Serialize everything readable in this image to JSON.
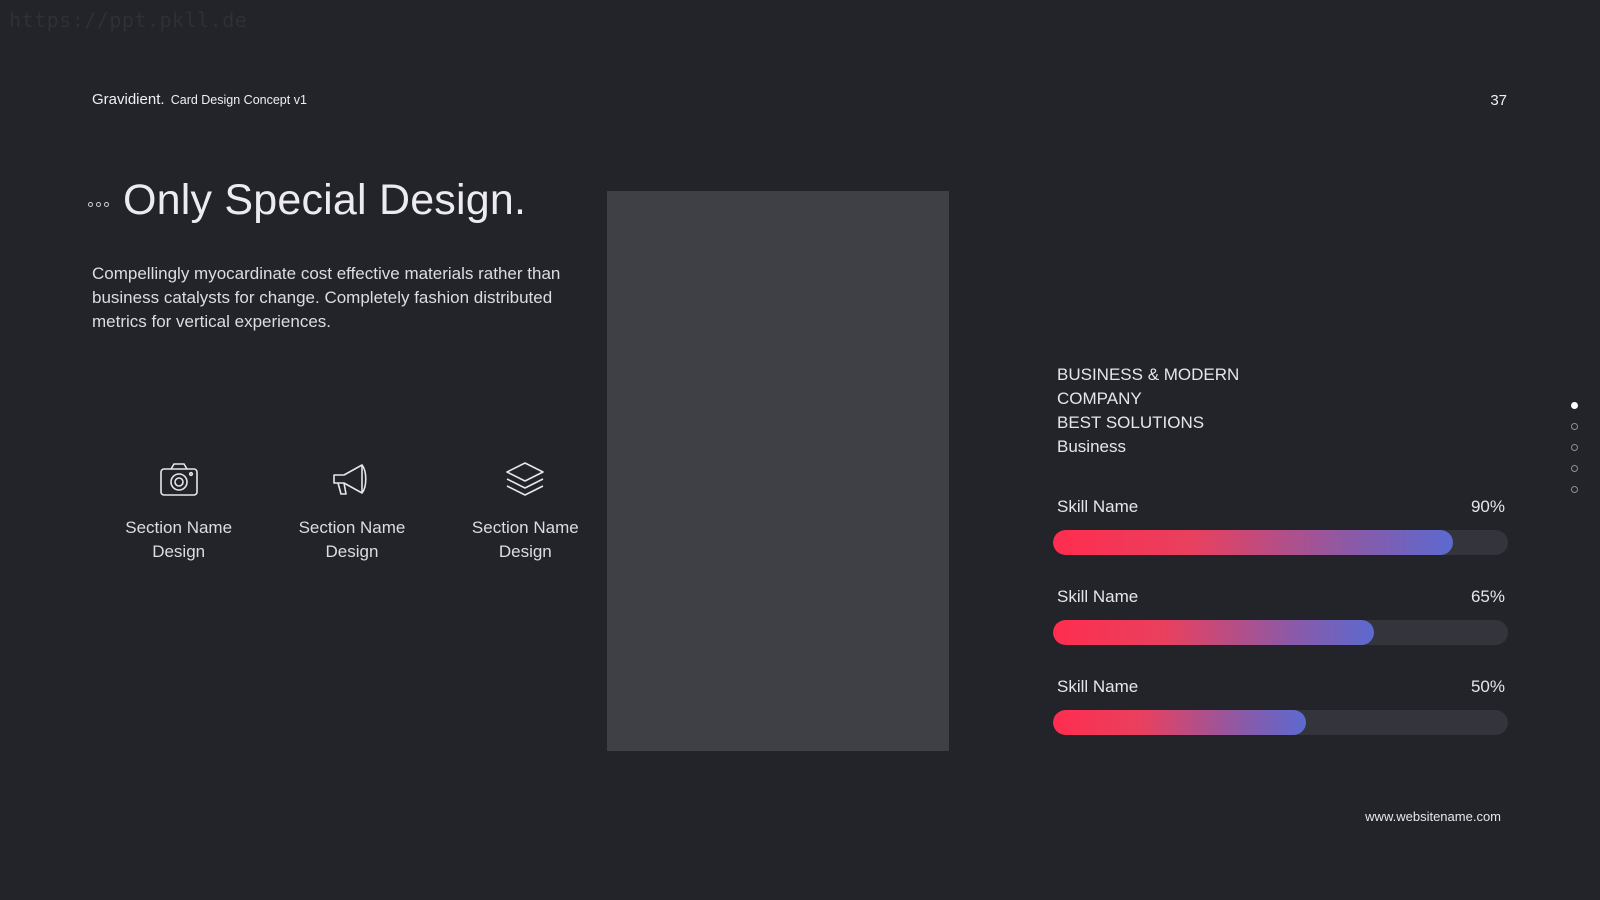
{
  "watermark": "https://ppt.pkll.de",
  "header": {
    "brand": "Gravidient.",
    "subtitle": "Card Design Concept v1",
    "page_number": "37"
  },
  "main": {
    "title": "Only Special Design.",
    "description": "Compellingly myocardinate cost effective materials rather than business catalysts for change. Completely fashion distributed metrics for vertical experiences."
  },
  "features": [
    {
      "icon": "camera-icon",
      "label": "Section Name\nDesign"
    },
    {
      "icon": "megaphone-icon",
      "label": "Section Name\nDesign"
    },
    {
      "icon": "layers-icon",
      "label": "Section Name\nDesign"
    }
  ],
  "info": {
    "line1": "BUSINESS & MODERN",
    "line2": "COMPANY",
    "line3": "BEST SOLUTIONS",
    "line4": "Business"
  },
  "skills": [
    {
      "name": "Skill Name",
      "percent_label": "90%",
      "value": 0.88
    },
    {
      "name": "Skill Name",
      "percent_label": "65%",
      "value": 0.705
    },
    {
      "name": "Skill Name",
      "percent_label": "50%",
      "value": 0.556
    }
  ],
  "footer": {
    "website": "www.websitename.com"
  },
  "colors": {
    "background": "#23232a",
    "placeholder": "#3f4045",
    "gradient_start": "#ff2d4f",
    "gradient_end": "#5c6ad0"
  }
}
